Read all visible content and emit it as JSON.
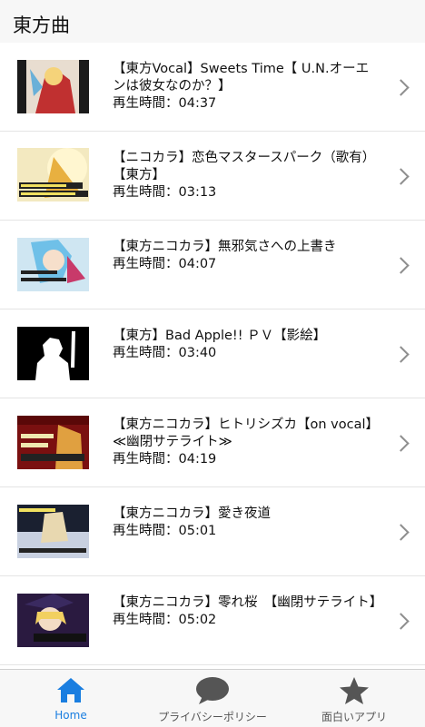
{
  "header": {
    "title": "東方曲"
  },
  "items": [
    {
      "title": "【東方Vocal】Sweets Time【 U.N.オーエンは彼女なのか？】",
      "duration": "再生時間：04:37",
      "thumb_icon": "video-thumbnail-icon"
    },
    {
      "title": "【ニコカラ】恋色マスタースパーク（歌有）【東方】",
      "duration": "再生時間：03:13",
      "thumb_icon": "video-thumbnail-icon"
    },
    {
      "title": "【東方ニコカラ】無邪気さへの上書き",
      "duration": "再生時間：04:07",
      "thumb_icon": "video-thumbnail-icon"
    },
    {
      "title": "【東方】Bad Apple!! ＰＶ【影絵】",
      "duration": "再生時間：03:40",
      "thumb_icon": "video-thumbnail-icon"
    },
    {
      "title": "【東方ニコカラ】ヒトリシズカ【on vocal】≪幽閉サテライト≫",
      "duration": "再生時間：04:19",
      "thumb_icon": "video-thumbnail-icon"
    },
    {
      "title": "【東方ニコカラ】愛き夜道",
      "duration": "再生時間：05:01",
      "thumb_icon": "video-thumbnail-icon"
    },
    {
      "title": "【東方ニコカラ】零れ桜　【幽閉サテライト】",
      "duration": "再生時間：05:02",
      "thumb_icon": "video-thumbnail-icon"
    }
  ],
  "tabs": [
    {
      "label": "Home",
      "icon": "home-icon",
      "active": true
    },
    {
      "label": "プライバシーポリシー",
      "icon": "speech-bubble-icon",
      "active": false
    },
    {
      "label": "面白いアプリ",
      "icon": "star-icon",
      "active": false
    }
  ],
  "colors": {
    "accent": "#1a7ee0",
    "tabbar_bg": "#f7f7f7",
    "icon_gray": "#555555"
  }
}
